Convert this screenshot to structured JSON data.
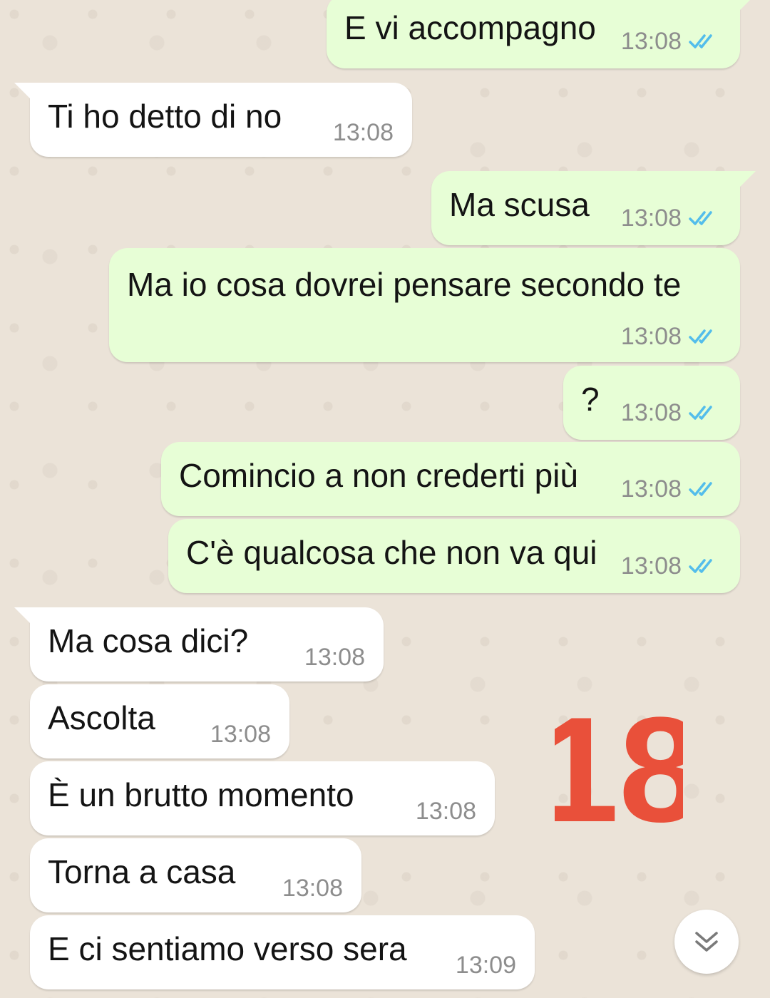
{
  "messages": [
    {
      "text": "E vi accompagno",
      "time": "13:08",
      "direction": "out",
      "read": true
    },
    {
      "text": "Ti ho detto di no",
      "time": "13:08",
      "direction": "in"
    },
    {
      "text": "Ma scusa",
      "time": "13:08",
      "direction": "out",
      "read": true
    },
    {
      "text": "Ma io cosa dovrei pensare secondo te",
      "time": "13:08",
      "direction": "out",
      "read": true
    },
    {
      "text": "?",
      "time": "13:08",
      "direction": "out",
      "read": true
    },
    {
      "text": "Comincio a non crederti più",
      "time": "13:08",
      "direction": "out",
      "read": true
    },
    {
      "text": "C'è qualcosa che non va qui",
      "time": "13:08",
      "direction": "out",
      "read": true
    },
    {
      "text": "Ma cosa dici?",
      "time": "13:08",
      "direction": "in"
    },
    {
      "text": "Ascolta",
      "time": "13:08",
      "direction": "in"
    },
    {
      "text": "È un brutto momento",
      "time": "13:08",
      "direction": "in"
    },
    {
      "text": "Torna a casa",
      "time": "13:08",
      "direction": "in"
    },
    {
      "text": "E ci sentiamo verso sera",
      "time": "13:09",
      "direction": "in"
    }
  ],
  "overlay_number": "18",
  "colors": {
    "background": "#ebe3d8",
    "incoming_bubble": "#ffffff",
    "outgoing_bubble": "#e7fed6",
    "read_ticks": "#53bdeb",
    "overlay_number": "#e9503a"
  },
  "icons": {
    "read_receipt": "double-check-icon",
    "scroll_down": "chevron-double-down-icon"
  }
}
